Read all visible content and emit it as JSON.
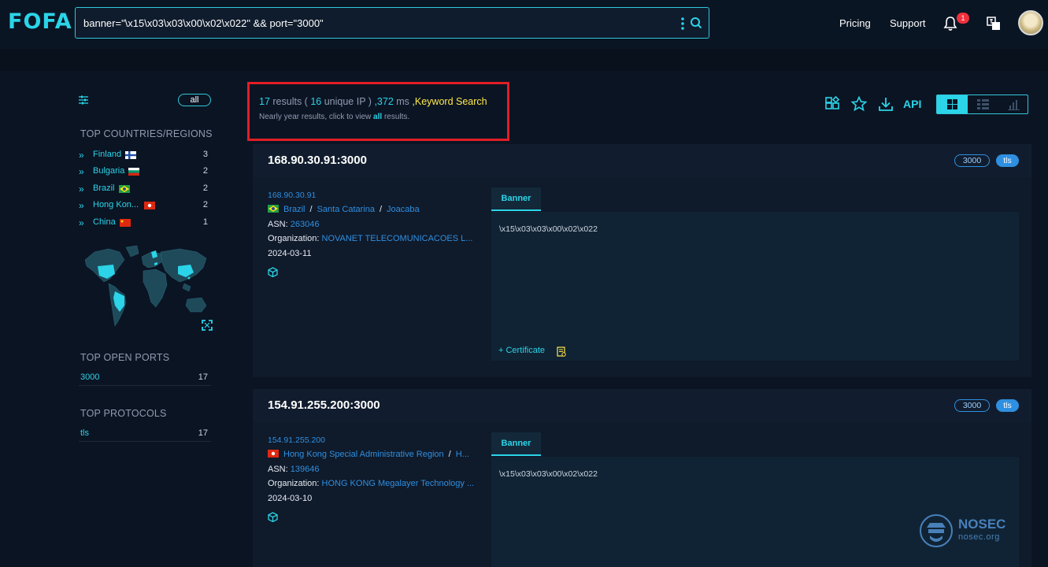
{
  "header": {
    "logo": "FOFA",
    "query": "banner=\"\\x15\\x03\\x03\\x00\\x02\\x022\" && port=\"3000\"",
    "nav": [
      "Pricing",
      "Support"
    ],
    "notification_count": "1"
  },
  "sidebar": {
    "all_label": "all",
    "countries_title": "TOP COUNTRIES/REGIONS",
    "countries": [
      {
        "name": "Finland",
        "count": "3"
      },
      {
        "name": "Bulgaria",
        "count": "2"
      },
      {
        "name": "Brazil",
        "count": "2"
      },
      {
        "name": "Hong Kon...",
        "count": "2"
      },
      {
        "name": "China",
        "count": "1"
      }
    ],
    "ports_title": "TOP OPEN PORTS",
    "ports": [
      {
        "key": "3000",
        "count": "17"
      }
    ],
    "protocols_title": "TOP PROTOCOLS",
    "protocols": [
      {
        "key": "tls",
        "count": "17"
      }
    ]
  },
  "summary": {
    "results": "17",
    "results_label": "results (",
    "unique": "16",
    "unique_label": "unique IP )",
    "ms": ",372",
    "ms_label": "ms",
    "keyword": ",Keyword Search",
    "sub_prefix": "Nearly year results, click to view",
    "sub_link": "all",
    "sub_suffix": "results."
  },
  "toolbar": {
    "api_label": "API"
  },
  "results": [
    {
      "title": "168.90.30.91:3000",
      "port": "3000",
      "protocol": "tls",
      "ip": "168.90.30.91",
      "country": "Brazil",
      "region": "Santa Catarina",
      "city": "Joacaba",
      "asn_label": "ASN:",
      "asn": "263046",
      "org_label": "Organization:",
      "org": "NOVANET TELECOMUNICACOES L...",
      "date": "2024-03-11",
      "banner_tab": "Banner",
      "banner": "\\x15\\x03\\x03\\x00\\x02\\x022",
      "certificate": "+ Certificate"
    },
    {
      "title": "154.91.255.200:3000",
      "port": "3000",
      "protocol": "tls",
      "ip": "154.91.255.200",
      "country": "Hong Kong Special Administrative Region",
      "region": "H...",
      "asn_label": "ASN:",
      "asn": "139646",
      "org_label": "Organization:",
      "org": "HONG KONG Megalayer Technology ...",
      "date": "2024-03-10",
      "banner_tab": "Banner",
      "banner": "\\x15\\x03\\x03\\x00\\x02\\x022"
    }
  ],
  "watermark": {
    "name": "NOSEC",
    "site": "nosec.org"
  },
  "colors": {
    "accent": "#2bd4e8",
    "link": "#2f8fe0",
    "keyword": "#ffe94a",
    "highlight_box": "#e01e26"
  }
}
